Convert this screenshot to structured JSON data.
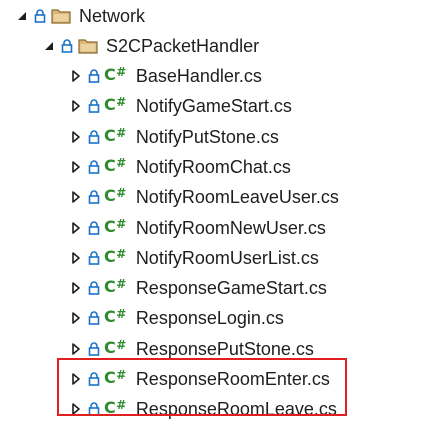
{
  "tree": {
    "root": {
      "label": "Network",
      "expanded": true,
      "icon": "folder-icon"
    },
    "subfolder": {
      "label": "S2CPacketHandler",
      "expanded": true,
      "icon": "folder-icon"
    },
    "file_icon_text": "C",
    "file_icon_hash": "#",
    "files": [
      {
        "label": "BaseHandler.cs"
      },
      {
        "label": "NotifyGameStart.cs"
      },
      {
        "label": "NotifyPutStone.cs"
      },
      {
        "label": "NotifyRoomChat.cs"
      },
      {
        "label": "NotifyRoomLeaveUser.cs"
      },
      {
        "label": "NotifyRoomNewUser.cs"
      },
      {
        "label": "NotifyRoomUserList.cs"
      },
      {
        "label": "ResponseGameStart.cs"
      },
      {
        "label": "ResponseLogin.cs"
      },
      {
        "label": "ResponsePutStone.cs"
      },
      {
        "label": "ResponseRoomEnter.cs"
      },
      {
        "label": "ResponseRoomLeave.cs"
      }
    ]
  },
  "colors": {
    "folder": "#dcb67a",
    "lock": "#1a73c8",
    "csharp": "#2e8b2e",
    "highlight": "#e02020",
    "text": "#1e1e1e"
  }
}
